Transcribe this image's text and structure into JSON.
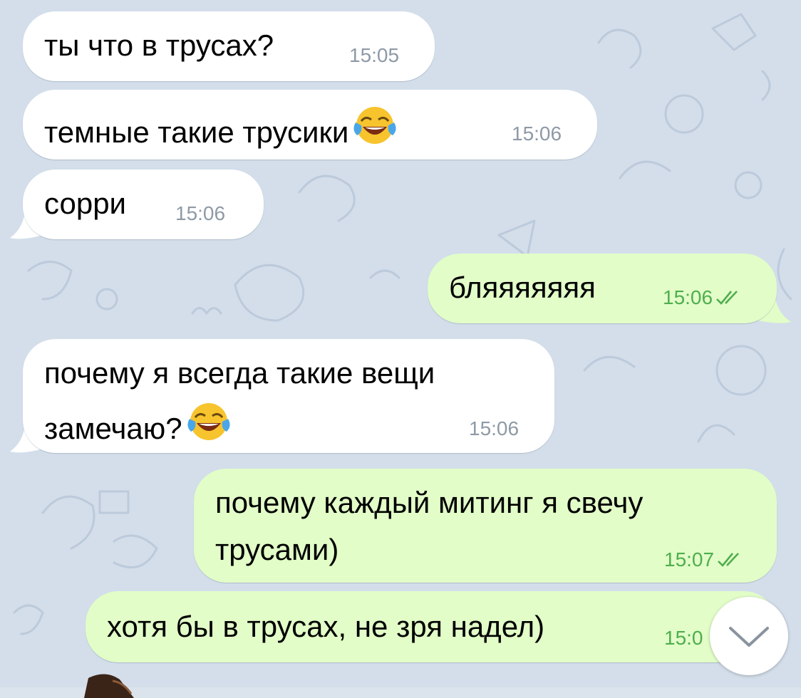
{
  "messages": [
    {
      "direction": "incoming",
      "text": "ты что в трусах?",
      "time": "15:05"
    },
    {
      "direction": "incoming",
      "text": "темные такие трусики",
      "emoji": "face-with-tears-of-joy",
      "time": "15:06"
    },
    {
      "direction": "incoming",
      "text": "сорри",
      "time": "15:06"
    },
    {
      "direction": "outgoing",
      "text": "бляяяяяяя",
      "time": "15:06",
      "status": "read"
    },
    {
      "direction": "incoming",
      "line1": "почему я всегда такие вещи",
      "line2": "замечаю?",
      "emoji": "face-with-tears-of-joy",
      "time": "15:06"
    },
    {
      "direction": "outgoing",
      "line1": "почему каждый митинг я свечу",
      "line2": "трусами)",
      "time": "15:07",
      "status": "read"
    },
    {
      "direction": "outgoing",
      "text": "хотя бы в трусах, не зря надел)",
      "time": "15:0",
      "status": "read"
    }
  ],
  "scroll_to_bottom": {
    "icon": "chevron-down-icon"
  },
  "colors": {
    "wallpaper": "#d3deea",
    "incoming_bubble": "#ffffff",
    "outgoing_bubble": "#e2fdc8",
    "outgoing_time": "#4fae4e",
    "incoming_time": "#8e9aa6"
  }
}
